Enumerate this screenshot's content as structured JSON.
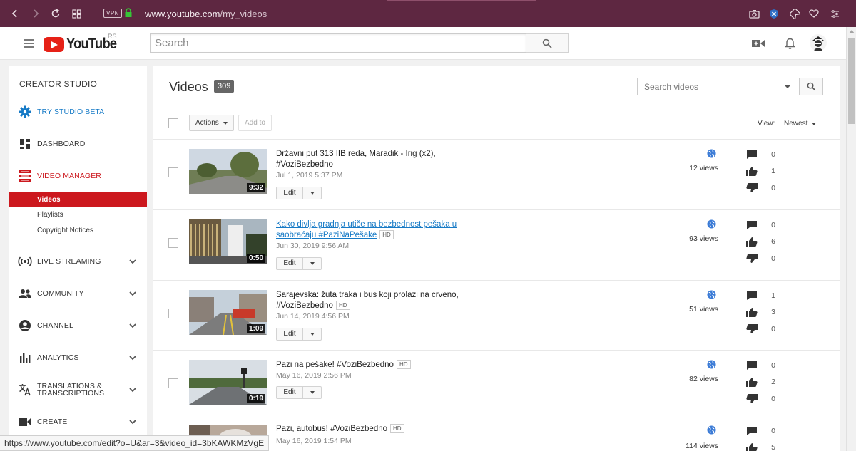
{
  "browser": {
    "vpn_label": "VPN",
    "url_domain": "www.youtube.com",
    "url_path": "/my_videos"
  },
  "header": {
    "logo_text": "YouTube",
    "country_code": "RS",
    "search_placeholder": "Search"
  },
  "sidebar": {
    "title": "CREATOR STUDIO",
    "items": [
      {
        "label": "TRY STUDIO BETA",
        "icon": "gear-icon"
      },
      {
        "label": "DASHBOARD",
        "icon": "dashboard-icon"
      },
      {
        "label": "VIDEO MANAGER",
        "icon": "video-manager-icon"
      },
      {
        "label": "LIVE STREAMING",
        "icon": "live-streaming-icon"
      },
      {
        "label": "COMMUNITY",
        "icon": "community-icon"
      },
      {
        "label": "CHANNEL",
        "icon": "channel-icon"
      },
      {
        "label": "ANALYTICS",
        "icon": "analytics-icon"
      },
      {
        "label": "TRANSLATIONS & TRANSCRIPTIONS",
        "icon": "translate-icon"
      },
      {
        "label": "CREATE",
        "icon": "create-icon"
      }
    ],
    "sub_items": [
      "Videos",
      "Playlists",
      "Copyright Notices"
    ]
  },
  "main": {
    "title": "Videos",
    "count": "309",
    "search_placeholder": "Search videos",
    "actions_label": "Actions",
    "add_to_label": "Add to",
    "view_label": "View:",
    "sort_value": "Newest",
    "edit_label": "Edit",
    "hd_label": "HD"
  },
  "videos": [
    {
      "title": "Državni put 313 IIB reda, Maradik - Irig (x2), #VoziBezbedno",
      "hd": false,
      "date": "Jul 1, 2019 5:37 PM",
      "duration": "9:32",
      "views": "12 views",
      "comments": "0",
      "likes": "1",
      "dislikes": "0"
    },
    {
      "title": "Kako divlja gradnja utiče na bezbednost pešaka u saobraćaju #PaziNaPešake",
      "hd": true,
      "date": "Jun 30, 2019 9:56 AM",
      "duration": "0:50",
      "views": "93 views",
      "comments": "0",
      "likes": "6",
      "dislikes": "0"
    },
    {
      "title": "Sarajevska: žuta traka i bus koji prolazi na crveno, #VoziBezbedno",
      "hd": true,
      "date": "Jun 14, 2019 4:56 PM",
      "duration": "1:09",
      "views": "51 views",
      "comments": "1",
      "likes": "3",
      "dislikes": "0"
    },
    {
      "title": "Pazi na pešake! #VoziBezbedno",
      "hd": true,
      "date": "May 16, 2019 2:56 PM",
      "duration": "0:19",
      "views": "82 views",
      "comments": "0",
      "likes": "2",
      "dislikes": "0"
    },
    {
      "title": "Pazi, autobus! #VoziBezbedno",
      "hd": true,
      "date": "May 16, 2019 1:54 PM",
      "duration": "",
      "views": "114 views",
      "comments": "0",
      "likes": "5",
      "dislikes": ""
    }
  ],
  "status_bar": "https://www.youtube.com/edit?o=U&ar=3&video_id=3bKAWKMzVgE",
  "colors": {
    "accent_red": "#cc181e",
    "link_blue": "#167ac6",
    "browser_bar": "#5e2741"
  }
}
